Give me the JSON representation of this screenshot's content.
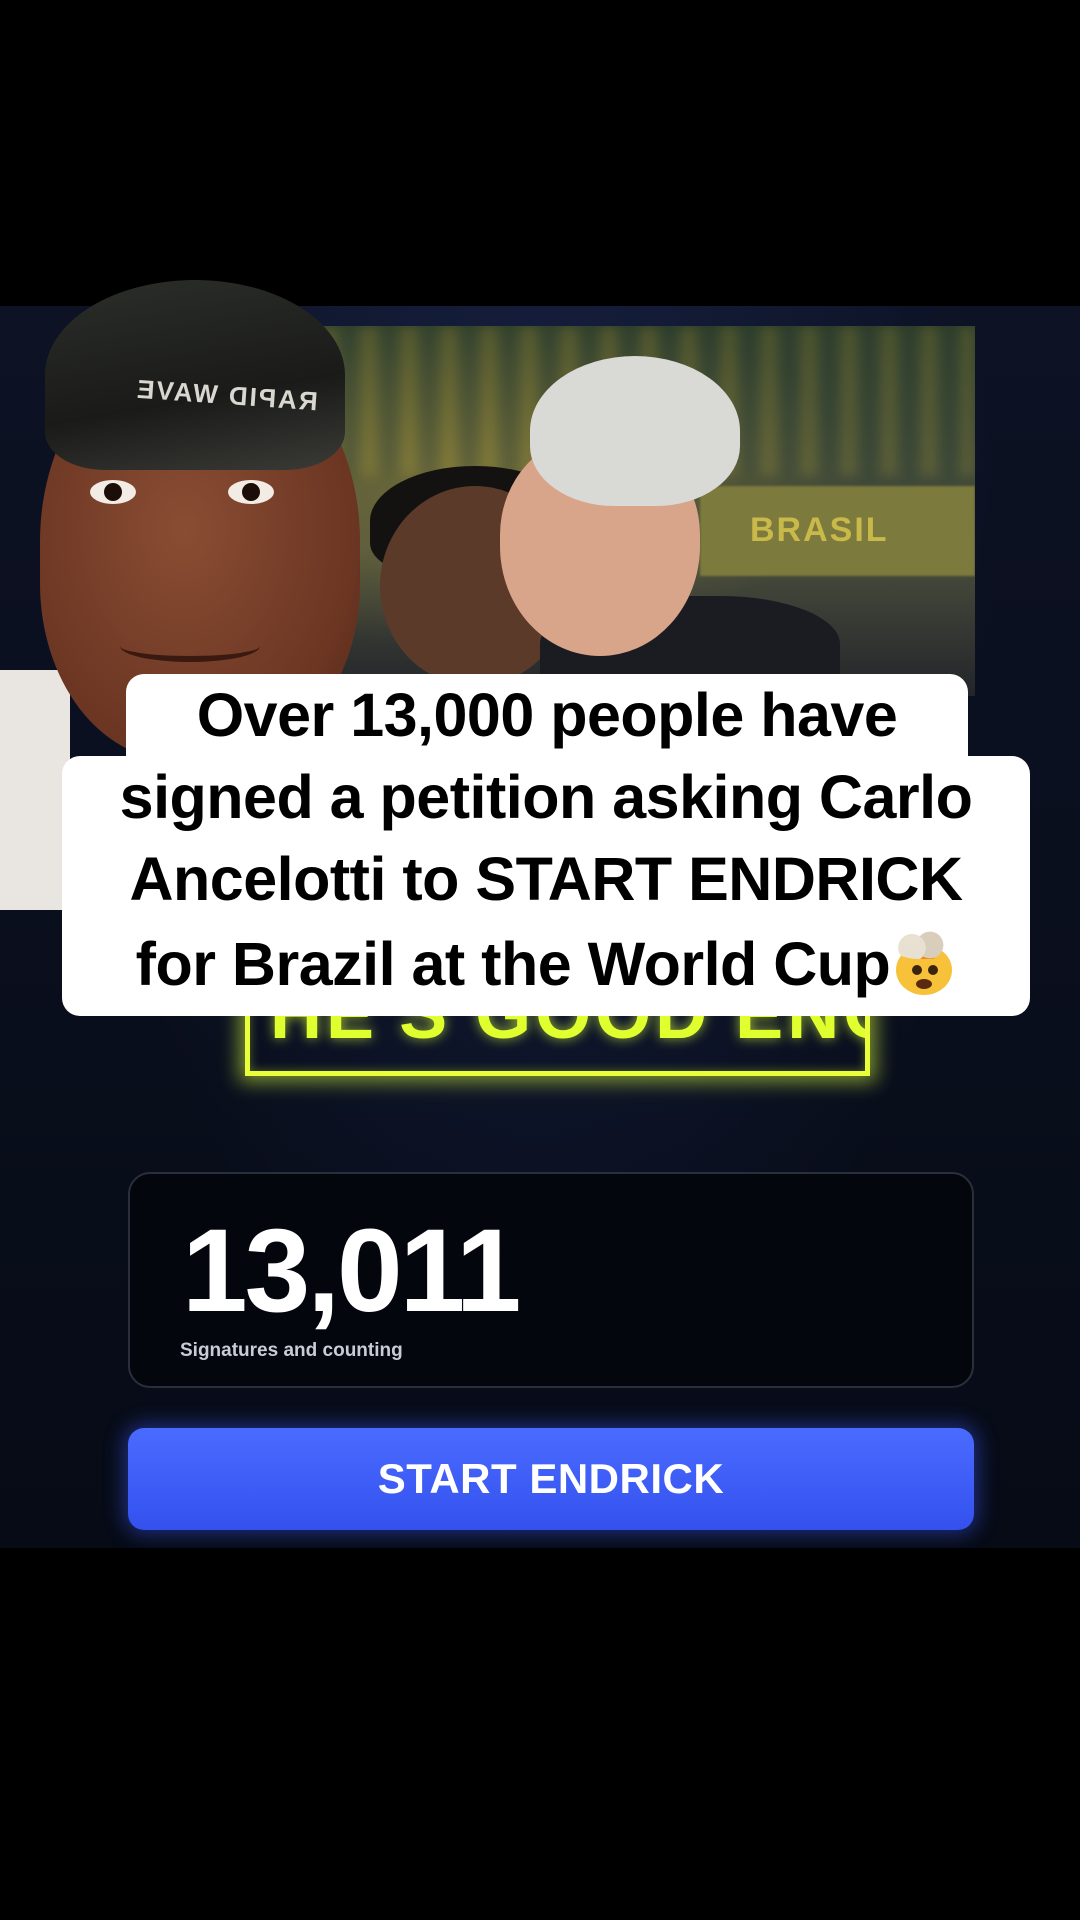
{
  "caption": {
    "line1": "Over 13,000 people have",
    "line2": "signed a petition asking Carlo",
    "line3": "Ancelotti to START ENDRICK",
    "line4": "for Brazil at the World Cup",
    "emoji": "exploding-head-emoji"
  },
  "photo": {
    "banner_text": "BRASIL",
    "durag_text": "RAPID WAVE"
  },
  "neon_sign": {
    "text": "HE'S GOOD ENOUGH"
  },
  "counter": {
    "value": "13,011",
    "label": "Signatures and counting"
  },
  "cta": {
    "label": "START ENDRICK"
  },
  "colors": {
    "background": "#000000",
    "site_background": "#0a0f1e",
    "button": "#3d5cf6",
    "neon": "#e8ff3a",
    "caption_bg": "#ffffff",
    "caption_text": "#000000"
  }
}
